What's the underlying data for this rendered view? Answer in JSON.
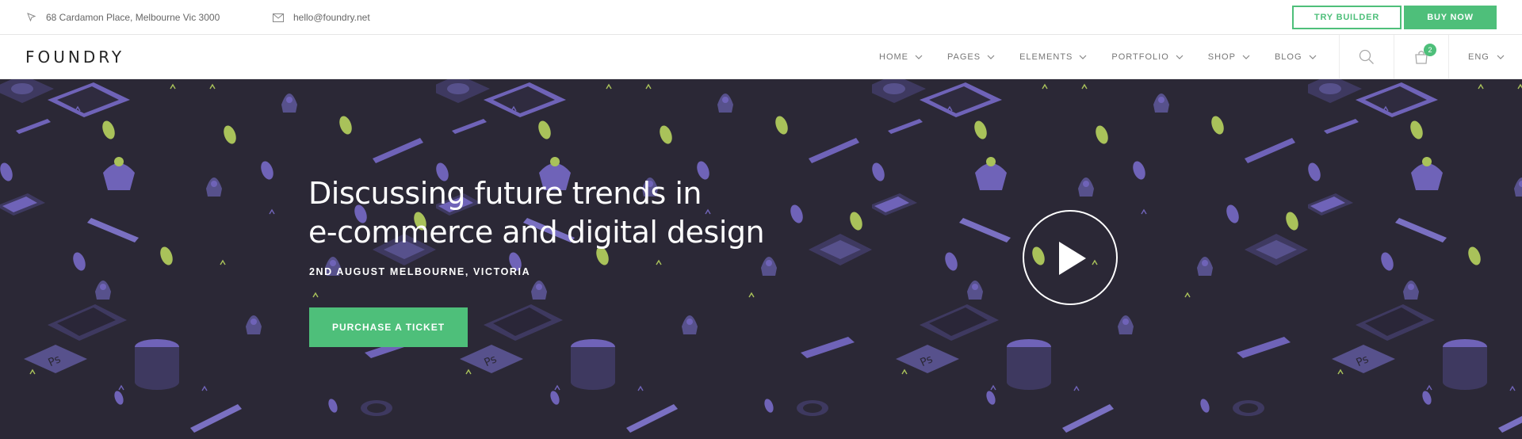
{
  "topbar": {
    "address": "68 Cardamon Place, Melbourne Vic 3000",
    "email": "hello@foundry.net",
    "try_builder_label": "TRY BUILDER",
    "buy_now_label": "BUY NOW"
  },
  "nav": {
    "logo": "FOUNDRY",
    "items": [
      {
        "label": "HOME"
      },
      {
        "label": "PAGES"
      },
      {
        "label": "ELEMENTS"
      },
      {
        "label": "PORTFOLIO"
      },
      {
        "label": "SHOP"
      },
      {
        "label": "BLOG"
      }
    ],
    "cart_count": "2",
    "language": "ENG",
    "icons": [
      "search-icon",
      "cart-icon",
      "chevron-down-icon"
    ]
  },
  "hero": {
    "title_line1": "Discussing future trends in",
    "title_line2": "e-commerce and digital design",
    "subtitle": "2ND AUGUST MELBOURNE, VICTORIA",
    "cta_label": "PURCHASE A TICKET",
    "play_icon": "play-icon"
  },
  "colors": {
    "accent": "#4ebf7a",
    "hero_bg": "#2b2836",
    "pattern_purple": "#6f63b8",
    "pattern_green": "#a9c25a"
  }
}
